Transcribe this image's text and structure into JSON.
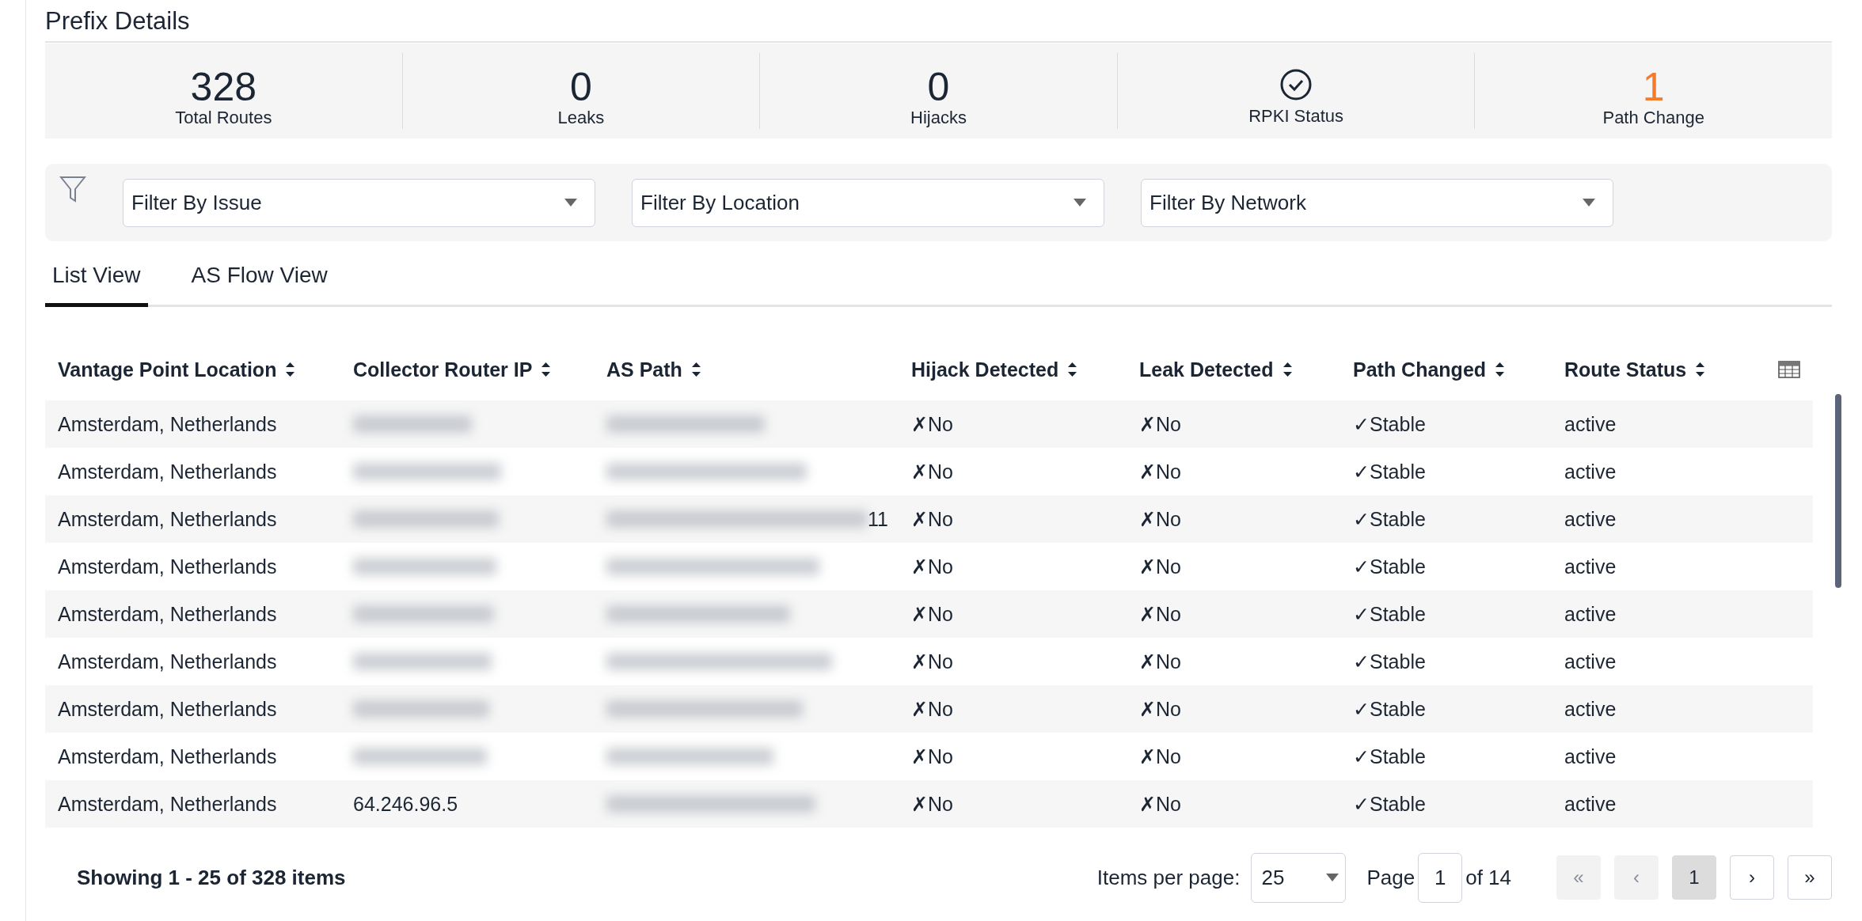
{
  "title": "Prefix Details",
  "summary": [
    {
      "kind": "number",
      "value": "328",
      "label": "Total Routes",
      "alert": false
    },
    {
      "kind": "number",
      "value": "0",
      "label": "Leaks",
      "alert": false
    },
    {
      "kind": "number",
      "value": "0",
      "label": "Hijacks",
      "alert": false
    },
    {
      "kind": "status",
      "label": "RPKI Status"
    },
    {
      "kind": "number",
      "value": "1",
      "label": "Path Change",
      "alert": true
    }
  ],
  "filters": [
    {
      "placeholder": "Filter By Issue"
    },
    {
      "placeholder": "Filter By Location"
    },
    {
      "placeholder": "Filter By Network"
    }
  ],
  "tabs": [
    {
      "label": "List View",
      "selected": true
    },
    {
      "label": "AS Flow View",
      "selected": false
    }
  ],
  "table": {
    "columns": [
      {
        "label": "Vantage Point Location",
        "sortable": true
      },
      {
        "label": "Collector Router IP",
        "sortable": true
      },
      {
        "label": "AS Path",
        "sortable": true
      },
      {
        "label": "Hijack Detected",
        "sortable": true
      },
      {
        "label": "Leak Detected",
        "sortable": true
      },
      {
        "label": "Path Changed",
        "sortable": true
      },
      {
        "label": "Route Status",
        "sortable": true
      }
    ],
    "rows": [
      {
        "location": "Amsterdam, Netherlands",
        "ip_blurred": true,
        "as_path_blurred": true,
        "hijack": "✗No",
        "leak": "✗No",
        "path_changed": "✓Stable",
        "route_status": "active"
      },
      {
        "location": "Amsterdam, Netherlands",
        "ip_blurred": true,
        "as_path_blurred": true,
        "hijack": "✗No",
        "leak": "✗No",
        "path_changed": "✓Stable",
        "route_status": "active"
      },
      {
        "location": "Amsterdam, Netherlands",
        "ip_blurred": true,
        "as_path_blurred": true,
        "as_path": "11",
        "hijack": "✗No",
        "leak": "✗No",
        "path_changed": "✓Stable",
        "route_status": "active"
      },
      {
        "location": "Amsterdam, Netherlands",
        "ip_blurred": true,
        "as_path_blurred": true,
        "hijack": "✗No",
        "leak": "✗No",
        "path_changed": "✓Stable",
        "route_status": "active"
      },
      {
        "location": "Amsterdam, Netherlands",
        "ip_blurred": true,
        "as_path_blurred": true,
        "hijack": "✗No",
        "leak": "✗No",
        "path_changed": "✓Stable",
        "route_status": "active"
      },
      {
        "location": "Amsterdam, Netherlands",
        "ip_blurred": true,
        "as_path_blurred": true,
        "hijack": "✗No",
        "leak": "✗No",
        "path_changed": "✓Stable",
        "route_status": "active"
      },
      {
        "location": "Amsterdam, Netherlands",
        "ip_blurred": true,
        "as_path_blurred": true,
        "hijack": "✗No",
        "leak": "✗No",
        "path_changed": "✓Stable",
        "route_status": "active"
      },
      {
        "location": "Amsterdam, Netherlands",
        "ip_blurred": true,
        "as_path_blurred": true,
        "hijack": "✗No",
        "leak": "✗No",
        "path_changed": "✓Stable",
        "route_status": "active"
      },
      {
        "location": "Amsterdam, Netherlands",
        "ip_blurred": false,
        "ip": "64.246.96.5",
        "as_path_blurred": true,
        "hijack": "✗No",
        "leak": "✗No",
        "path_changed": "✓Stable",
        "route_status": "active"
      }
    ]
  },
  "footer": {
    "showing": "Showing 1 - 25 of 328 items",
    "per_page_label": "Items per page:",
    "per_page": "25",
    "page_label": "Page",
    "page": "1",
    "page_total": "of 14",
    "pages": [
      {
        "label": "«",
        "disabled": true,
        "selected": false
      },
      {
        "label": "‹",
        "disabled": true,
        "selected": false
      },
      {
        "label": "1",
        "disabled": false,
        "selected": true
      },
      {
        "label": "›",
        "disabled": false,
        "selected": false
      },
      {
        "label": "»",
        "disabled": false,
        "selected": false
      }
    ]
  }
}
